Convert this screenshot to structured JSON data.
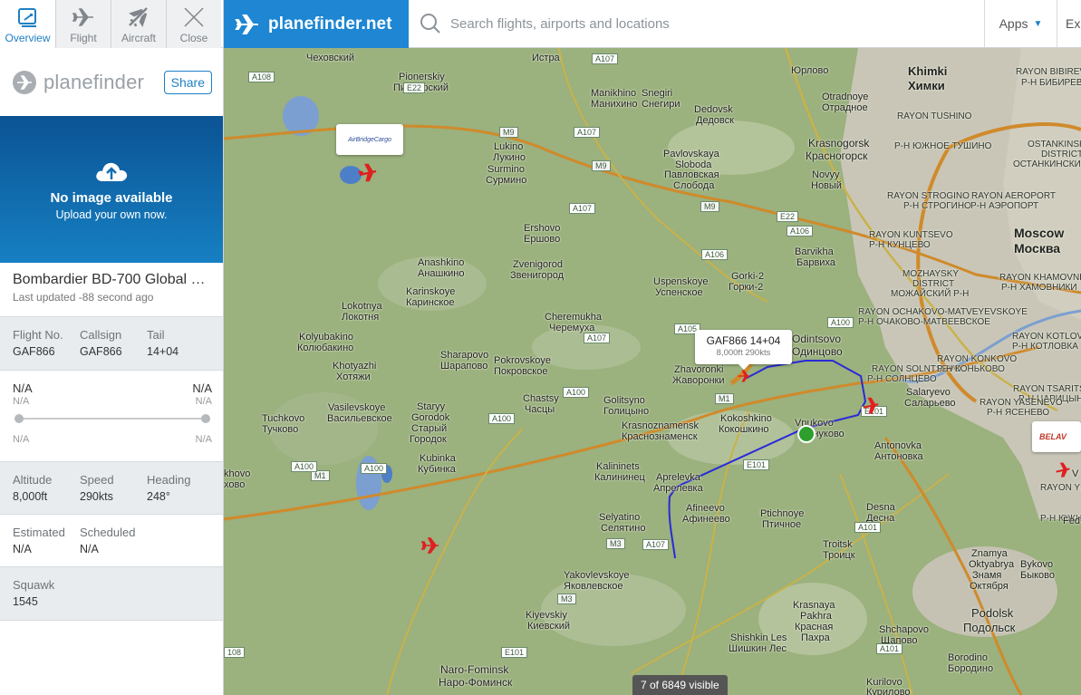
{
  "tabs": [
    {
      "label": "Overview",
      "icon": "overview-icon",
      "active": true
    },
    {
      "label": "Flight",
      "icon": "plane-icon",
      "active": false
    },
    {
      "label": "Aircraft",
      "icon": "aircraft-icon",
      "active": false
    },
    {
      "label": "Close",
      "icon": "close-icon",
      "active": false
    }
  ],
  "brand": {
    "name": "planefinder",
    "share_label": "Share"
  },
  "photo": {
    "title": "No image available",
    "subtitle": "Upload your own now."
  },
  "aircraft": {
    "type": "Bombardier BD-700 Global 5...",
    "last_updated": "Last updated -88 second ago"
  },
  "ids": {
    "flight_label": "Flight No.",
    "flight_value": "GAF866",
    "callsign_label": "Callsign",
    "callsign_value": "GAF866",
    "tail_label": "Tail",
    "tail_value": "14+04"
  },
  "route": {
    "origin": "N/A",
    "origin_sub": "N/A",
    "origin_time": "N/A",
    "destination": "N/A",
    "destination_sub": "N/A",
    "destination_time": "N/A",
    "progress": 1.0
  },
  "flight_stats": {
    "altitude_label": "Altitude",
    "altitude_value": "8,000ft",
    "speed_label": "Speed",
    "speed_value": "290kts",
    "heading_label": "Heading",
    "heading_value": "248°"
  },
  "times": {
    "estimated_label": "Estimated",
    "estimated_value": "N/A",
    "scheduled_label": "Scheduled",
    "scheduled_value": "N/A"
  },
  "squawk": {
    "label": "Squawk",
    "value": "1545"
  },
  "header": {
    "logo_text": "planefinder.net",
    "search_placeholder": "Search flights, airports and locations",
    "apps_label": "Apps",
    "extra_label": "Ex"
  },
  "map": {
    "callout_title": "GAF866 14+04",
    "callout_sub": "8,000ft 290kts",
    "airline_tag_1": "AirBridgeCargo",
    "airline_tag_2": "BELAV",
    "visible_count": "7 of 6849 visible",
    "labels": {
      "chekhovsky": "Чеховский",
      "istra": "Истра",
      "pionerskiy": "Pionerskiy",
      "pionerskiy_ru": "Пионерский",
      "manikhino": "Manikhino",
      "manikhino_ru": "Манихино",
      "snegiri": "Snegiri",
      "snegiri_ru": "Снегири",
      "yurlovo": "Юрлово",
      "khimki": "Khimki",
      "khimki_ru": "Химки",
      "rayon_bibirevo": "RAYON BIBIREVO",
      "rayon_bibirevo_ru": "Р-Н БИБИРЕВО",
      "otradnoye": "Otradnoye",
      "otradnoye_ru": "Отрадное",
      "dedovsk": "Dedovsk",
      "dedovsk_ru": "Дедовск",
      "lukino": "Lukino",
      "lukino_ru": "Лукино",
      "surmino": "Surmino",
      "surmino_ru": "Сурмино",
      "pavlovskaya": "Pavlovskaya",
      "sloboda": "Sloboda",
      "pavlovskaya_ru": "Павловская",
      "sloboda_ru": "Слобода",
      "krasnogorsk": "Krasnogorsk",
      "krasnogorsk_ru": "Красногорск",
      "novyy": "Novyy",
      "novyy_ru": "Новый",
      "rayon_tushino": "RAYON TUSHINO",
      "rayon_tushino_ru": "Р-Н ЮЖНОЕ ТУШИНО",
      "rayon_strogino": "RAYON STROGINO",
      "rayon_strogino_ru": "Р-Н СТРОГИНО",
      "ostankinskiy": "OSTANKINSKIY",
      "ostankinskiy2": "DISTRICT",
      "ostankinskiy_ru": "ОСТАНКИНСКИЙ Р-Н",
      "aeroport": "RAYON AEROPORT",
      "aeroport_ru": "Р-Н АЭРОПОРТ",
      "ershovo": "Ershovo",
      "ershovo_ru": "Ершово",
      "zvenigorod": "Zvenigorod",
      "zvenigorod_ru": "Звенигород",
      "anashkino": "Anashkino",
      "anashkino_ru": "Анашкино",
      "karinskoye": "Karinskoye",
      "karinskoye_ru": "Каринское",
      "uspenskoye": "Uspenskoye",
      "uspenskoye_ru": "Успенское",
      "gorki2": "Gorki-2",
      "gorki2_ru": "Горки-2",
      "barvikha": "Barvikha",
      "barvikha_ru": "Барвиха",
      "moscow": "Moscow",
      "moscow_ru": "Москва",
      "kuntsevo": "RAYON KUNTSEVO",
      "kuntsevo_ru": "Р-Н КУНЦЕВО",
      "khamovniki": "RAYON KHAMOVNIKI",
      "khamovniki_ru": "Р-Н ХАМОВНИКИ",
      "mozhaysky": "MOZHAYSKY",
      "mozhaysky2": "DISTRICT",
      "mozhaysky_ru": "МОЖАЙСКИЙ Р-Н",
      "ochakovo": "RAYON OCHAKOVO-MATVEYEVSKOYE",
      "ochakovo_ru": "Р-Н ОЧАКОВО-МАТВЕЕВСКОЕ",
      "kotlovka": "RAYON KOTLOVKA",
      "kotlovka_ru": "Р-Н КОТЛОВКА",
      "lokotnya": "Lokotnya",
      "lokotnya_ru": "Локотня",
      "cheremukha": "Cheremukha",
      "cheremukha_ru": "Черемуха",
      "kolyubakino": "Kolyubakino",
      "kolyubakino_ru": "Колюбакино",
      "sharapovo": "Sharapovo",
      "sharapovo_ru": "Шарапово",
      "pokrovskoye": "Pokrovskoye",
      "pokrovskoye_ru": "Покровское",
      "khotyazhi": "Khotyazhi",
      "khotyazhi_ru": "Хотяжи",
      "zhavoronki": "Zhavoronki",
      "zhavoronki_ru": "Жаворонки",
      "odintsovo": "Odintsovo",
      "odintsovo_ru": "Одинцово",
      "solntsevo": "RAYON SOLNTSEVO",
      "solntsevo_ru": "Р-Н СОЛНЦЕВО",
      "konkovo": "RAYON KONKOVO",
      "konkovo_ru": "Р-Н КОНЬКОВО",
      "tsaritsyno": "RAYON TSARITSYNO",
      "tsaritsyno_ru": "Р-Н ЦАРИЦЫНО",
      "yasenevo": "RAYON YASENEVO",
      "yasenevo_ru": "Р-Н ЯСЕНЕВО",
      "vasilevskoye": "Vasilevskoye",
      "vasilevskoye_ru": "Васильевское",
      "staryy": "Staryy",
      "gorodok": "Gorodok",
      "staryy_ru": "Старый",
      "gorodok_ru": "Городок",
      "chastsy": "Chastsy",
      "chastsy_ru": "Часцы",
      "golitsyno": "Golitsyno",
      "golitsyno_ru": "Голицыно",
      "salaryevo": "Salaryevo",
      "salaryevo_ru": "Саларьево",
      "tuchkovo": "Tuchkovo",
      "tuchkovo_ru": "Тучково",
      "kokoshkino": "Kokoshkino",
      "kokoshkino_ru": "Кокошкино",
      "vnukovo": "Vnukovo",
      "vnukovo_ru": "Внуково",
      "krasnoznamensk": "Krasnoznamensk",
      "krasnoznamensk_ru": "Краснознаменск",
      "antonovka": "Antonovka",
      "antonovka_ru": "Антоновка",
      "kubinka": "Kubinka",
      "kubinka_ru": "Кубинка",
      "kalininets": "Kalininets",
      "kalininets_ru": "Калининец",
      "aprelevka": "Aprelevka",
      "aprelevka_ru": "Апрелевка",
      "yuzhnoye_butovo": "RAYON YUZHNOYE BUTOVO",
      "yuzhnoye_butovo_ru": "Р-Н ЮЖНОЕ БУТОВО",
      "afineevo": "Afineevo",
      "afineevo_ru": "Афинеево",
      "selyatino": "Selyatino",
      "selyatino_ru": "Селятино",
      "ptichnoye": "Ptichnoye",
      "ptichnoye_ru": "Птичное",
      "desna": "Desna",
      "desna_ru": "Десна",
      "troitsk": "Troitsk",
      "troitsk_ru": "Троицк",
      "znamya": "Znamya",
      "oktyabrya": "Oktyabrya",
      "znamya_ru": "Знамя",
      "oktyabrya_ru": "Октября",
      "bykovo": "Bykovo",
      "bykovo_ru": "Быково",
      "yakovlevskoye": "Yakovlevskoye",
      "yakovlevskoye_ru": "Яковлевское",
      "krasnaya": "Krasnaya",
      "pakhra": "Pakhra",
      "krasnaya_ru": "Красная",
      "pakhra_ru": "Пахра",
      "podolsk": "Podolsk",
      "podolsk_ru": "Подольск",
      "kiyevskiy": "Kiyevskiy",
      "kiyevskiy_ru": "Киевский",
      "shchapovo": "Shchapovo",
      "shchapovo_ru": "Щапово",
      "shishkin": "Shishkin Les",
      "shishkin_ru": "Шишкин Лес",
      "naro_fominsk": "Naro-Fominsk",
      "naro_fominsk_ru": "Наро-Фоминск",
      "borodino": "Borodino",
      "borodino_ru": "Бородино",
      "kurilovo": "Kurilovo",
      "kurilovo_ru": "Курилово",
      "khovo": "khovo",
      "khovo_ru": "хово",
      "fed": "Fed",
      "v": "V"
    },
    "roads": {
      "a108": "A108",
      "e22": "E22",
      "a107a": "A107",
      "m9a": "M9",
      "m9b": "M9",
      "a107b": "A107",
      "a107c": "A107",
      "m9c": "M9",
      "e22b": "E22",
      "a106a": "A106",
      "a106b": "A106",
      "a100a": "A100",
      "a105": "A105",
      "a107d": "A107",
      "a100b": "A100",
      "a100c": "A100",
      "m1a": "M1",
      "e101a": "E101",
      "m1b": "M1",
      "a100d": "A100",
      "a100e": "A100",
      "e101b": "E101",
      "m3a": "M3",
      "a107e": "A107",
      "a101a": "A101",
      "m3b": "M3",
      "e101c": "E101",
      "a101b": "A101",
      "r108": "108",
      "e101d": "E101",
      "m1c": "M1"
    }
  },
  "colors": {
    "accent": "#1e80c4",
    "logo_bg": "#1e86d2",
    "track": "#2a2ad8",
    "plane": "#e02020",
    "map_bg": "#9bb17e"
  }
}
